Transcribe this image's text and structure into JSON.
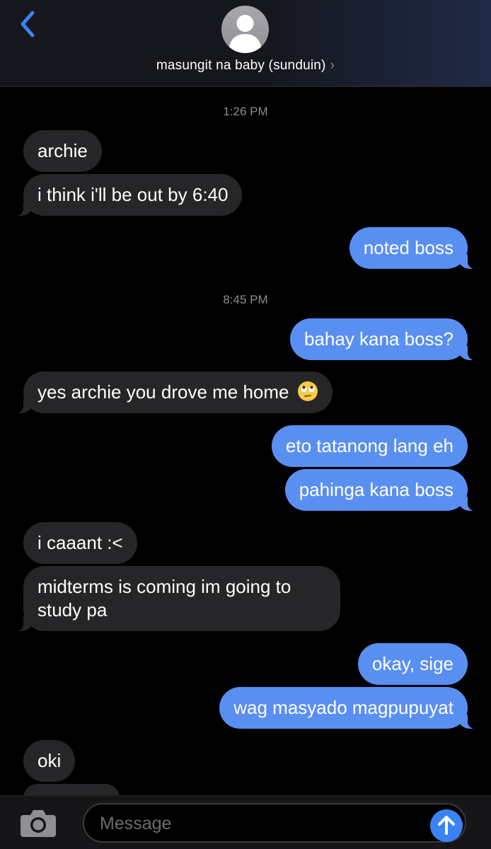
{
  "header": {
    "contact_name": "masungit na baby (sunduin)",
    "chevron": "›"
  },
  "timestamps": [
    "1:26 PM",
    "8:45 PM"
  ],
  "messages": [
    {
      "from": "them",
      "text": "archie"
    },
    {
      "from": "them",
      "text": "i think i'll be out by 6:40"
    },
    {
      "from": "me",
      "text": "noted boss"
    },
    {
      "from": "me",
      "text": "bahay kana boss?"
    },
    {
      "from": "them",
      "text": "yes archie you drove me home",
      "emoji": "face-with-rolling-eyes"
    },
    {
      "from": "me",
      "text": "eto tatanong lang eh"
    },
    {
      "from": "me",
      "text": "pahinga kana boss"
    },
    {
      "from": "them",
      "text": "i caaant :<"
    },
    {
      "from": "them",
      "text": "midterms is coming im going to study pa"
    },
    {
      "from": "me",
      "text": "okay, sige"
    },
    {
      "from": "me",
      "text": "wag masyado magpupuyat"
    },
    {
      "from": "them",
      "text": "oki"
    }
  ],
  "input": {
    "placeholder": "Message"
  },
  "colors": {
    "outgoing_bubble": "#5a8ff2",
    "incoming_bubble": "#262629",
    "accent": "#3b82f6",
    "background": "#000000"
  },
  "icons": [
    "chevron-left-icon",
    "avatar-person-icon",
    "camera-icon",
    "send-arrow-icon"
  ]
}
